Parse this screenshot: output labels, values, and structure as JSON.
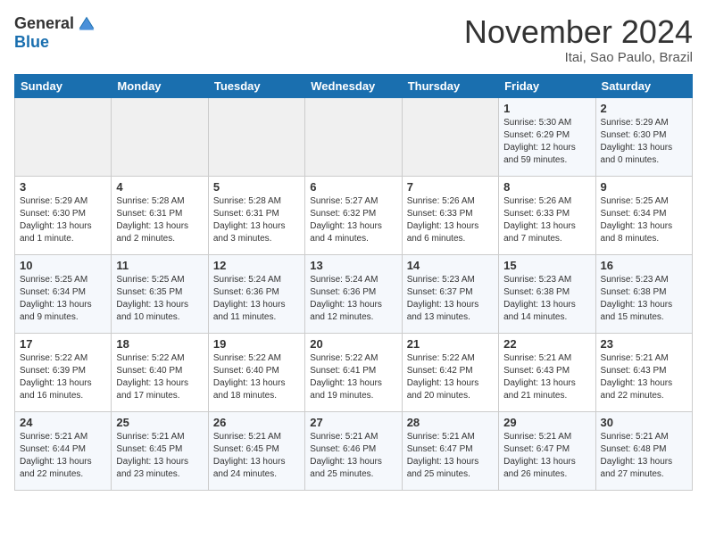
{
  "header": {
    "logo_general": "General",
    "logo_blue": "Blue",
    "month_title": "November 2024",
    "location": "Itai, Sao Paulo, Brazil"
  },
  "calendar": {
    "days_of_week": [
      "Sunday",
      "Monday",
      "Tuesday",
      "Wednesday",
      "Thursday",
      "Friday",
      "Saturday"
    ],
    "weeks": [
      [
        {
          "day": "",
          "info": ""
        },
        {
          "day": "",
          "info": ""
        },
        {
          "day": "",
          "info": ""
        },
        {
          "day": "",
          "info": ""
        },
        {
          "day": "",
          "info": ""
        },
        {
          "day": "1",
          "info": "Sunrise: 5:30 AM\nSunset: 6:29 PM\nDaylight: 12 hours and 59 minutes."
        },
        {
          "day": "2",
          "info": "Sunrise: 5:29 AM\nSunset: 6:30 PM\nDaylight: 13 hours and 0 minutes."
        }
      ],
      [
        {
          "day": "3",
          "info": "Sunrise: 5:29 AM\nSunset: 6:30 PM\nDaylight: 13 hours and 1 minute."
        },
        {
          "day": "4",
          "info": "Sunrise: 5:28 AM\nSunset: 6:31 PM\nDaylight: 13 hours and 2 minutes."
        },
        {
          "day": "5",
          "info": "Sunrise: 5:28 AM\nSunset: 6:31 PM\nDaylight: 13 hours and 3 minutes."
        },
        {
          "day": "6",
          "info": "Sunrise: 5:27 AM\nSunset: 6:32 PM\nDaylight: 13 hours and 4 minutes."
        },
        {
          "day": "7",
          "info": "Sunrise: 5:26 AM\nSunset: 6:33 PM\nDaylight: 13 hours and 6 minutes."
        },
        {
          "day": "8",
          "info": "Sunrise: 5:26 AM\nSunset: 6:33 PM\nDaylight: 13 hours and 7 minutes."
        },
        {
          "day": "9",
          "info": "Sunrise: 5:25 AM\nSunset: 6:34 PM\nDaylight: 13 hours and 8 minutes."
        }
      ],
      [
        {
          "day": "10",
          "info": "Sunrise: 5:25 AM\nSunset: 6:34 PM\nDaylight: 13 hours and 9 minutes."
        },
        {
          "day": "11",
          "info": "Sunrise: 5:25 AM\nSunset: 6:35 PM\nDaylight: 13 hours and 10 minutes."
        },
        {
          "day": "12",
          "info": "Sunrise: 5:24 AM\nSunset: 6:36 PM\nDaylight: 13 hours and 11 minutes."
        },
        {
          "day": "13",
          "info": "Sunrise: 5:24 AM\nSunset: 6:36 PM\nDaylight: 13 hours and 12 minutes."
        },
        {
          "day": "14",
          "info": "Sunrise: 5:23 AM\nSunset: 6:37 PM\nDaylight: 13 hours and 13 minutes."
        },
        {
          "day": "15",
          "info": "Sunrise: 5:23 AM\nSunset: 6:38 PM\nDaylight: 13 hours and 14 minutes."
        },
        {
          "day": "16",
          "info": "Sunrise: 5:23 AM\nSunset: 6:38 PM\nDaylight: 13 hours and 15 minutes."
        }
      ],
      [
        {
          "day": "17",
          "info": "Sunrise: 5:22 AM\nSunset: 6:39 PM\nDaylight: 13 hours and 16 minutes."
        },
        {
          "day": "18",
          "info": "Sunrise: 5:22 AM\nSunset: 6:40 PM\nDaylight: 13 hours and 17 minutes."
        },
        {
          "day": "19",
          "info": "Sunrise: 5:22 AM\nSunset: 6:40 PM\nDaylight: 13 hours and 18 minutes."
        },
        {
          "day": "20",
          "info": "Sunrise: 5:22 AM\nSunset: 6:41 PM\nDaylight: 13 hours and 19 minutes."
        },
        {
          "day": "21",
          "info": "Sunrise: 5:22 AM\nSunset: 6:42 PM\nDaylight: 13 hours and 20 minutes."
        },
        {
          "day": "22",
          "info": "Sunrise: 5:21 AM\nSunset: 6:43 PM\nDaylight: 13 hours and 21 minutes."
        },
        {
          "day": "23",
          "info": "Sunrise: 5:21 AM\nSunset: 6:43 PM\nDaylight: 13 hours and 22 minutes."
        }
      ],
      [
        {
          "day": "24",
          "info": "Sunrise: 5:21 AM\nSunset: 6:44 PM\nDaylight: 13 hours and 22 minutes."
        },
        {
          "day": "25",
          "info": "Sunrise: 5:21 AM\nSunset: 6:45 PM\nDaylight: 13 hours and 23 minutes."
        },
        {
          "day": "26",
          "info": "Sunrise: 5:21 AM\nSunset: 6:45 PM\nDaylight: 13 hours and 24 minutes."
        },
        {
          "day": "27",
          "info": "Sunrise: 5:21 AM\nSunset: 6:46 PM\nDaylight: 13 hours and 25 minutes."
        },
        {
          "day": "28",
          "info": "Sunrise: 5:21 AM\nSunset: 6:47 PM\nDaylight: 13 hours and 25 minutes."
        },
        {
          "day": "29",
          "info": "Sunrise: 5:21 AM\nSunset: 6:47 PM\nDaylight: 13 hours and 26 minutes."
        },
        {
          "day": "30",
          "info": "Sunrise: 5:21 AM\nSunset: 6:48 PM\nDaylight: 13 hours and 27 minutes."
        }
      ]
    ]
  }
}
